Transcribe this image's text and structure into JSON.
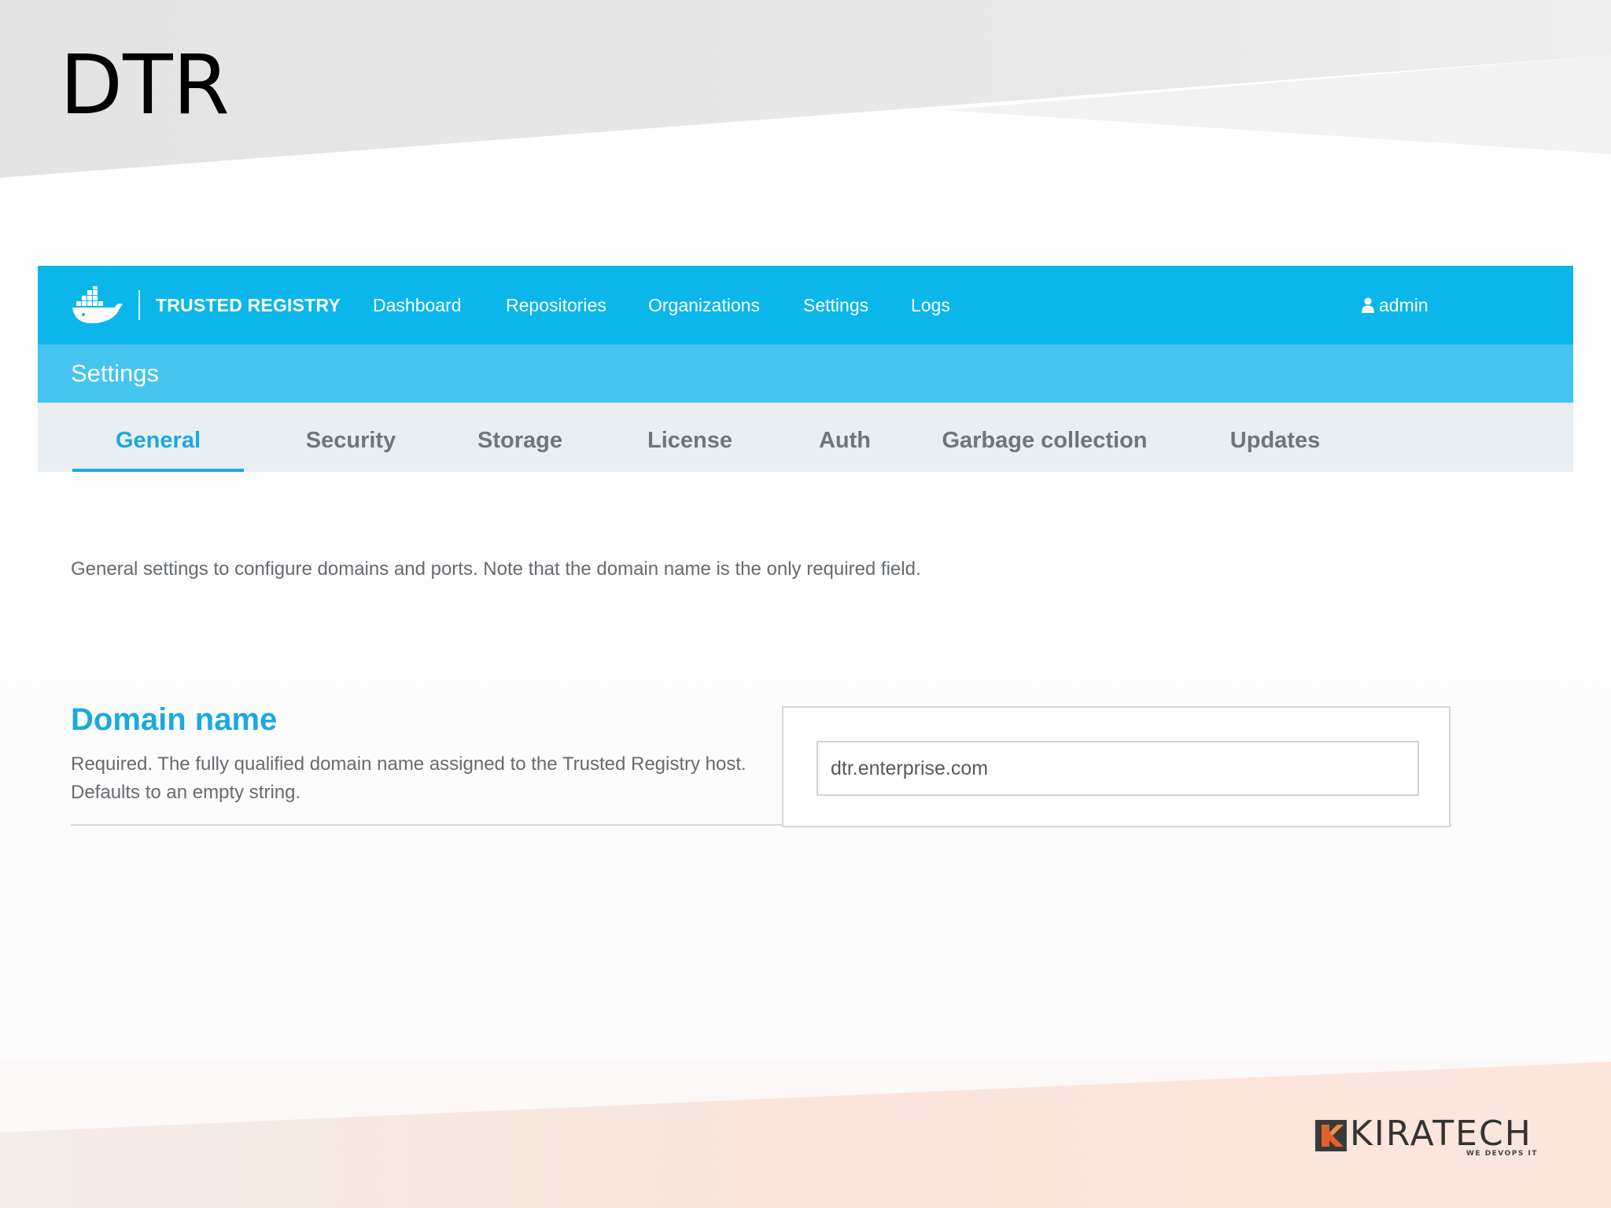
{
  "slide": {
    "title": "DTR",
    "colors": {
      "top_band": "#e6e6e6",
      "bottom_band": "#f9e4dc"
    }
  },
  "app": {
    "brand": {
      "name": "TRUSTED REGISTRY",
      "logo_icon": "docker-whale-icon"
    },
    "nav": [
      {
        "label": "Dashboard"
      },
      {
        "label": "Repositories"
      },
      {
        "label": "Organizations"
      },
      {
        "label": "Settings"
      },
      {
        "label": "Logs"
      }
    ],
    "user": {
      "label": "admin",
      "icon": "user-icon"
    },
    "page_title": "Settings",
    "tabs": [
      {
        "label": "General",
        "active": true
      },
      {
        "label": "Security",
        "active": false
      },
      {
        "label": "Storage",
        "active": false
      },
      {
        "label": "License",
        "active": false
      },
      {
        "label": "Auth",
        "active": false
      },
      {
        "label": "Garbage collection",
        "active": false
      },
      {
        "label": "Updates",
        "active": false
      }
    ],
    "intro": "General settings to configure domains and ports. Note that the domain name is the only required field.",
    "domain": {
      "heading": "Domain name",
      "description": "Required. The fully qualified domain name assigned to the Trusted Registry host. Defaults to an empty string.",
      "value": "dtr.enterprise.com"
    },
    "colors": {
      "nav_bg": "#0bb6ea",
      "subheader_bg": "#45c4ef",
      "tabbar_bg": "#e9eef3",
      "accent": "#1aa9de",
      "tab_text": "#6f757a"
    }
  },
  "footer": {
    "logo": "KIRATECH",
    "tagline": "WE DEVOPS IT",
    "logo_icon": "kiratech-k-icon"
  }
}
